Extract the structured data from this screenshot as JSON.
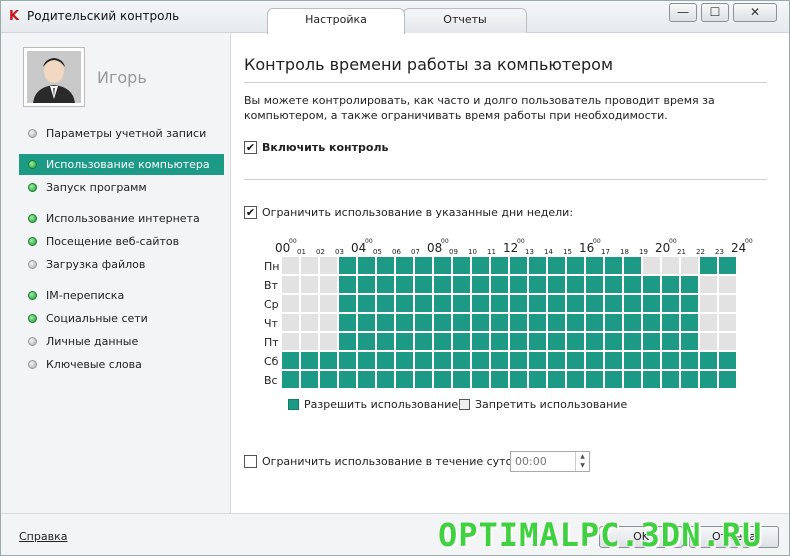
{
  "window": {
    "title": "Родительский контроль",
    "tabs": [
      {
        "label": "Настройка",
        "active": true
      },
      {
        "label": "Отчеты",
        "active": false
      }
    ],
    "controls": {
      "minimize": "—",
      "maximize": "☐",
      "close": "✕"
    }
  },
  "sidebar": {
    "user_name": "Игорь",
    "items": [
      {
        "label": "Параметры учетной записи",
        "status": "gray",
        "active": false
      },
      {
        "label": "Использование компьютера",
        "status": "green",
        "active": true
      },
      {
        "label": "Запуск программ",
        "status": "green",
        "active": false
      },
      {
        "label": "Использование интернета",
        "status": "green",
        "active": false
      },
      {
        "label": "Посещение веб-сайтов",
        "status": "green",
        "active": false
      },
      {
        "label": "Загрузка файлов",
        "status": "gray",
        "active": false
      },
      {
        "label": "IM-переписка",
        "status": "green",
        "active": false
      },
      {
        "label": "Социальные сети",
        "status": "green",
        "active": false
      },
      {
        "label": "Личные данные",
        "status": "gray",
        "active": false
      },
      {
        "label": "Ключевые слова",
        "status": "gray",
        "active": false
      }
    ]
  },
  "main": {
    "title": "Контроль времени работы за компьютером",
    "description": "Вы можете контролировать, как часто и долго пользователь проводит время за компьютером, а также ограничивать время работы при необходимости.",
    "enable_control": {
      "label": "Включить контроль",
      "checked": true
    },
    "limit_days": {
      "label": "Ограничить использование в указанные дни недели:",
      "checked": true
    },
    "schedule": {
      "days": [
        "Пн",
        "Вт",
        "Ср",
        "Чт",
        "Пт",
        "Сб",
        "Вс"
      ],
      "hour_labels": [
        "00",
        "01",
        "02",
        "03",
        "04",
        "05",
        "06",
        "07",
        "08",
        "09",
        "10",
        "11",
        "12",
        "13",
        "14",
        "15",
        "16",
        "17",
        "18",
        "19",
        "20",
        "21",
        "22",
        "23",
        "24"
      ],
      "big_hours": [
        "00",
        "04",
        "08",
        "12",
        "16",
        "20",
        "24"
      ],
      "superscript": "00",
      "allowed": [
        [
          0,
          0,
          0,
          1,
          1,
          1,
          1,
          1,
          1,
          1,
          1,
          1,
          1,
          1,
          1,
          1,
          1,
          1,
          1,
          0,
          0,
          0,
          1,
          1
        ],
        [
          0,
          0,
          0,
          1,
          1,
          1,
          1,
          1,
          1,
          1,
          1,
          1,
          1,
          1,
          1,
          1,
          1,
          1,
          1,
          1,
          1,
          1,
          0,
          0
        ],
        [
          0,
          0,
          0,
          1,
          1,
          1,
          1,
          1,
          1,
          1,
          1,
          1,
          1,
          1,
          1,
          1,
          1,
          1,
          1,
          1,
          1,
          1,
          0,
          0
        ],
        [
          0,
          0,
          0,
          1,
          1,
          1,
          1,
          1,
          1,
          1,
          1,
          1,
          1,
          1,
          1,
          1,
          1,
          1,
          1,
          1,
          1,
          1,
          0,
          0
        ],
        [
          0,
          0,
          0,
          1,
          1,
          1,
          1,
          1,
          1,
          1,
          1,
          1,
          1,
          1,
          1,
          1,
          1,
          1,
          1,
          1,
          1,
          1,
          0,
          0
        ],
        [
          1,
          1,
          1,
          1,
          1,
          1,
          1,
          1,
          1,
          1,
          1,
          1,
          1,
          1,
          1,
          1,
          1,
          1,
          1,
          1,
          1,
          1,
          1,
          1
        ],
        [
          1,
          1,
          1,
          1,
          1,
          1,
          1,
          1,
          1,
          1,
          1,
          1,
          1,
          1,
          1,
          1,
          1,
          1,
          1,
          1,
          1,
          1,
          1,
          1
        ]
      ]
    },
    "legend": {
      "allow": "Разрешить использование",
      "deny": "Запретить использование"
    },
    "limit_daily": {
      "label": "Ограничить использование в течение суток:",
      "checked": false,
      "value": "00:00"
    }
  },
  "footer": {
    "help": "Справка",
    "watermark": "OPTIMALPC.3DN.RU",
    "buttons": [
      "OK",
      "Отмена"
    ]
  },
  "colors": {
    "allowed": "#1d9a86",
    "denied": "#e2e2e2",
    "active_nav": "#1d9a86"
  }
}
